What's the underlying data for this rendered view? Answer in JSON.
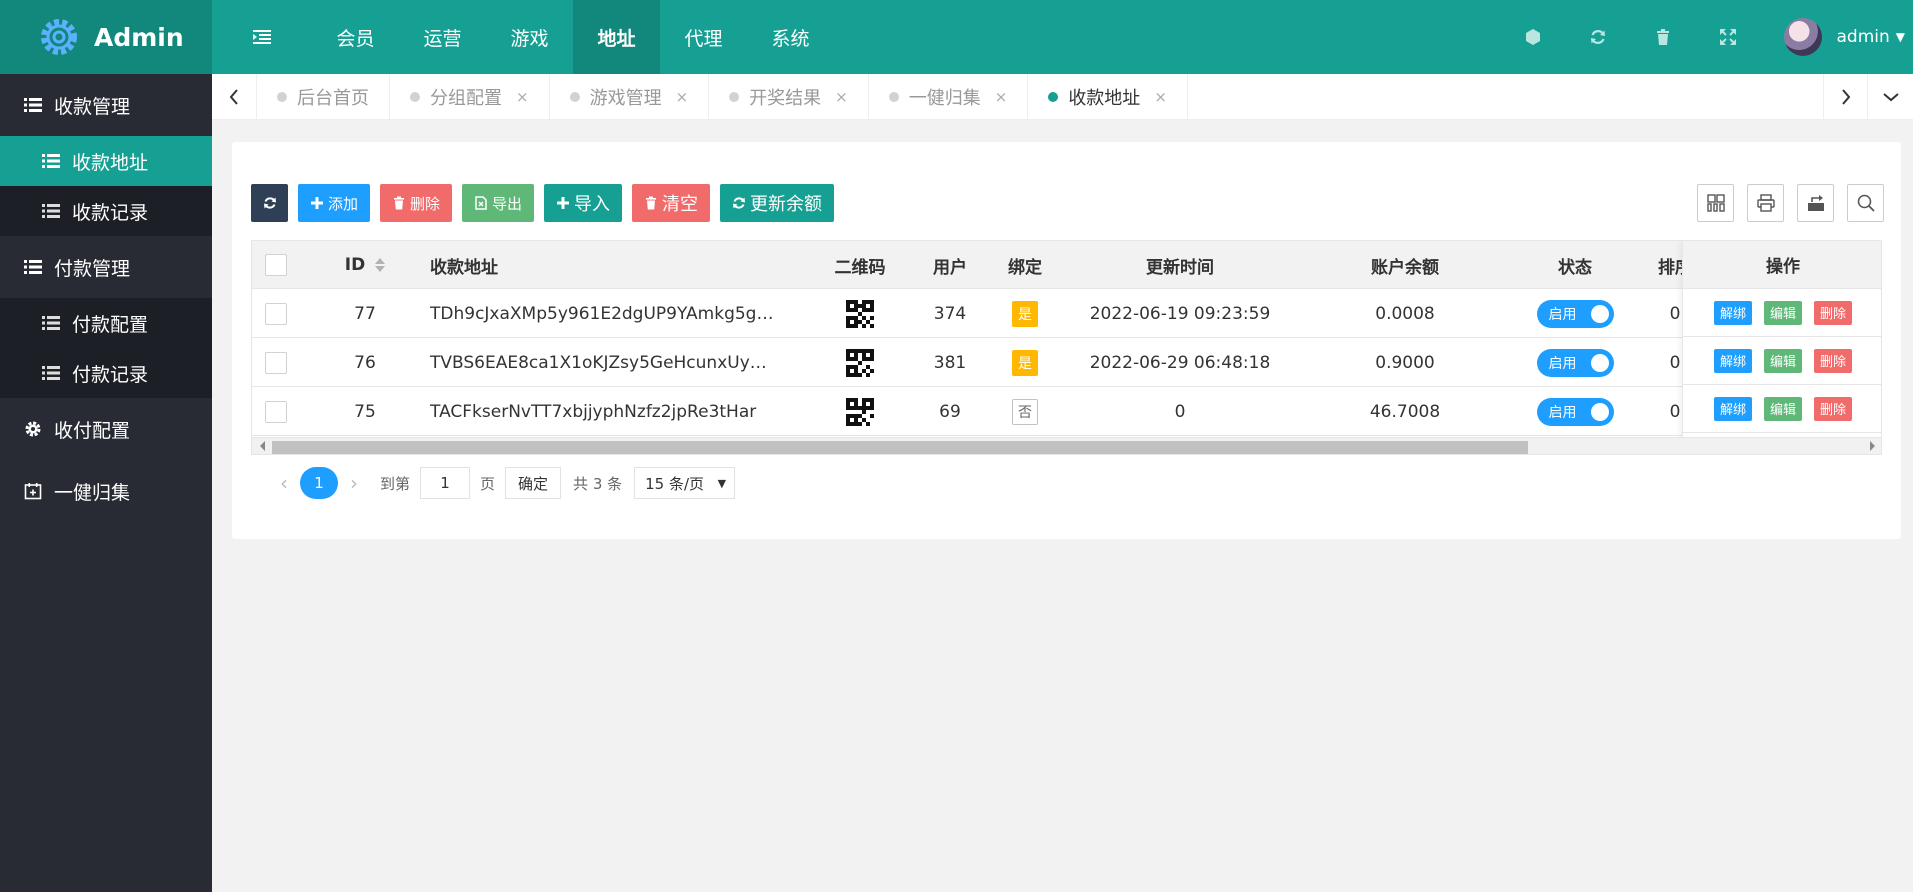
{
  "brand": "Admin",
  "topnav": [
    "会员",
    "运营",
    "游戏",
    "地址",
    "代理",
    "系统"
  ],
  "user": {
    "name": "admin"
  },
  "sidebar": {
    "groups": [
      {
        "label": "收款管理"
      },
      {
        "label": "付款管理"
      },
      {
        "label": "收付配置"
      },
      {
        "label": "一健归集"
      }
    ],
    "sub1": [
      "收款地址",
      "收款记录"
    ],
    "sub2": [
      "付款配置",
      "付款记录"
    ]
  },
  "tabs": [
    {
      "label": "后台首页"
    },
    {
      "label": "分组配置",
      "close": "×"
    },
    {
      "label": "游戏管理",
      "close": "×"
    },
    {
      "label": "开奖结果",
      "close": "×"
    },
    {
      "label": "一健归集",
      "close": "×"
    },
    {
      "label": "收款地址",
      "close": "×"
    }
  ],
  "toolbar": {
    "add": "添加",
    "delete": "删除",
    "export": "导出",
    "import": "导入",
    "clear": "清空",
    "refresh_balance": "更新余额"
  },
  "table": {
    "columns": [
      "ID",
      "收款地址",
      "二维码",
      "用户",
      "绑定",
      "更新时间",
      "账户余额",
      "状态",
      "排序",
      "操作"
    ],
    "rows": [
      {
        "id": "77",
        "address": "TDh9cJxaXMp5y961E2dgUP9YAmkg5g…",
        "user": "374",
        "bind": "是",
        "updated": "2022-06-19 09:23:59",
        "balance": "0.0008",
        "status": "启用",
        "sort": "0"
      },
      {
        "id": "76",
        "address": "TVBS6EAE8ca1X1oKJZsy5GeHcunxUy…",
        "user": "381",
        "bind": "是",
        "updated": "2022-06-29 06:48:18",
        "balance": "0.9000",
        "status": "启用",
        "sort": "0"
      },
      {
        "id": "75",
        "address": "TACFkserNvTT7xbjjyphNzfz2jpRe3tHar",
        "user": "69",
        "bind": "否",
        "updated": "0",
        "balance": "46.7008",
        "status": "启用",
        "sort": "0"
      }
    ],
    "actions": {
      "unbind": "解绑",
      "edit": "编辑",
      "delete": "删除"
    }
  },
  "pager": {
    "current": "1",
    "goto_label": "到第",
    "page_value": "1",
    "page_unit": "页",
    "confirm": "确定",
    "total": "共 3 条",
    "per_page": "15 条/页"
  },
  "colors": {
    "primary": "#16a093",
    "sidebar": "#282b33",
    "blue": "#1e9fff",
    "red": "#f26b6b",
    "green": "#5fb878",
    "yellow": "#ffb800"
  }
}
